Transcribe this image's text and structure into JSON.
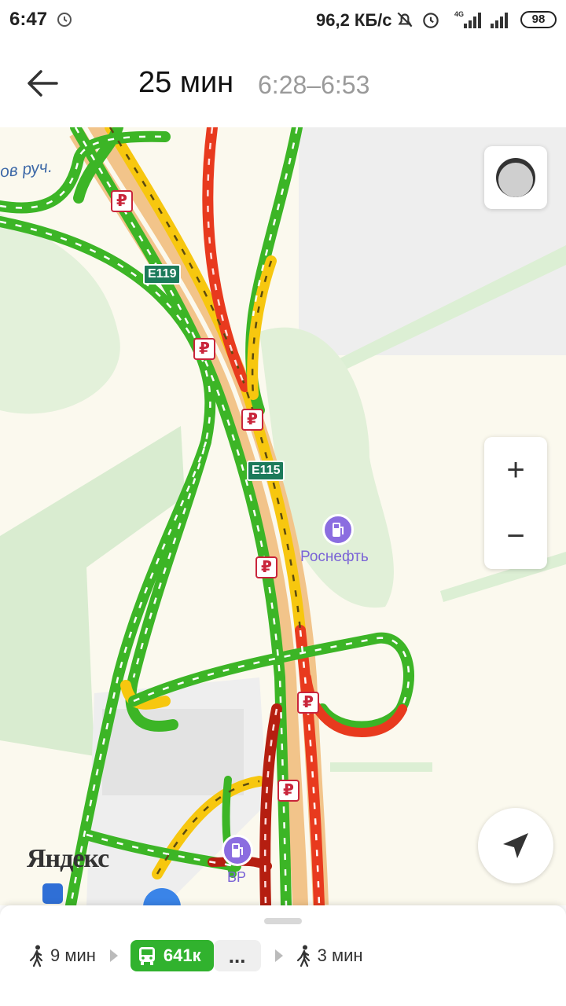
{
  "status_bar": {
    "time": "6:47",
    "net_speed": "96,2 КБ/с",
    "network_type": "4G",
    "battery": "98",
    "icons": [
      "alarm-icon",
      "mute-bell-icon",
      "alarm-icon",
      "signal-4g-icon",
      "signal-icon",
      "battery-icon"
    ]
  },
  "header": {
    "duration": "25 мин",
    "time_range": "6:28–6:53",
    "back_icon": "arrow-left-icon"
  },
  "map": {
    "stream_label": "ов руч.",
    "road_signs": [
      "E119",
      "E115"
    ],
    "poi": {
      "name": "Роснефть",
      "icon": "fuel-station-icon",
      "color": "#8b6de0"
    },
    "poi_bp": {
      "name": "BP",
      "icon": "fuel-station-icon"
    },
    "logo": "Яндекс",
    "ruble_symbol": "₽",
    "controls": {
      "zoom_in": "+",
      "zoom_out": "−",
      "layers_icon": "traffic-layer-icon",
      "locate_icon": "navigation-arrow-icon"
    },
    "traffic_colors": {
      "free": "#3cb526",
      "slow": "#f7c70f",
      "jam": "#e83a1e",
      "heavy": "#b51e10"
    }
  },
  "route": {
    "walk_start": "9 мин",
    "bus": "641к",
    "more": "...",
    "walk_end": "3 мин",
    "bus_color": "#31b22e"
  }
}
